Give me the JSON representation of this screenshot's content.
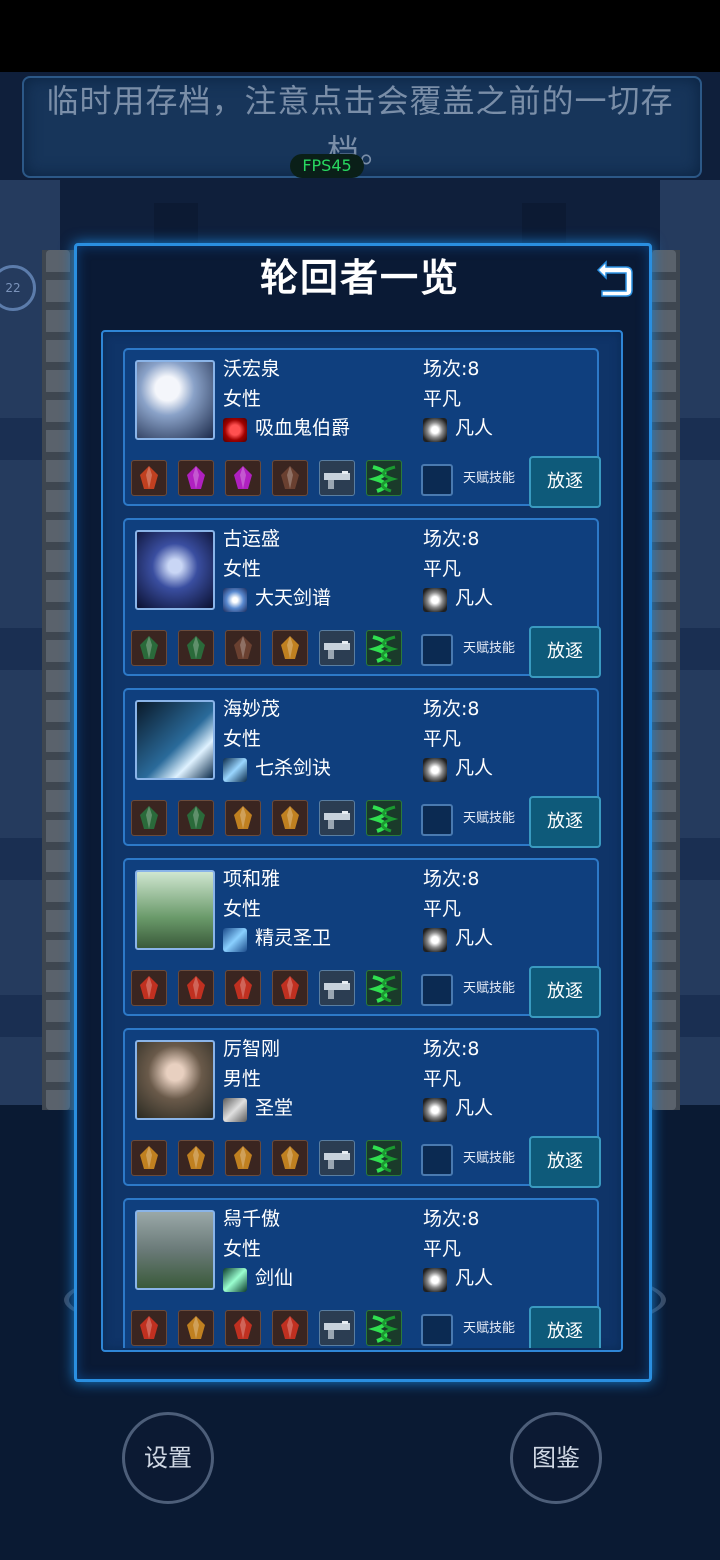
{
  "notice": {
    "line1": "临时用存档，注意点击会覆盖之前的一切存",
    "line2": "档。",
    "fps": "FPS45"
  },
  "side_badge": "22",
  "panel": {
    "title": "轮回者一览",
    "talent_label": "天赋技能",
    "exile_label": "放逐"
  },
  "characters": [
    {
      "name": "沃宏泉",
      "gender": "女性",
      "skill": "吸血鬼伯爵",
      "round": "场次:8",
      "rank": "平凡",
      "grade": "凡人",
      "skill_icon": "red-eye-icon"
    },
    {
      "name": "古运盛",
      "gender": "女性",
      "skill": "大天剑谱",
      "round": "场次:8",
      "rank": "平凡",
      "grade": "凡人",
      "skill_icon": "swirl-blade-icon"
    },
    {
      "name": "海妙茂",
      "gender": "女性",
      "skill": "七杀剑诀",
      "round": "场次:8",
      "rank": "平凡",
      "grade": "凡人",
      "skill_icon": "ice-slash-icon"
    },
    {
      "name": "项和雅",
      "gender": "女性",
      "skill": "精灵圣卫",
      "round": "场次:8",
      "rank": "平凡",
      "grade": "凡人",
      "skill_icon": "arrow-icon"
    },
    {
      "name": "厉智刚",
      "gender": "男性",
      "skill": "圣堂",
      "round": "场次:8",
      "rank": "平凡",
      "grade": "凡人",
      "skill_icon": "crossed-swords-icon"
    },
    {
      "name": "舄千傲",
      "gender": "女性",
      "skill": "剑仙",
      "round": "场次:8",
      "rank": "平凡",
      "grade": "凡人",
      "skill_icon": "sword-x-icon"
    }
  ],
  "bottom": {
    "settings_label": "设置",
    "codex_label": "图鉴"
  },
  "colors": {
    "panel_border": "#2a8fe0",
    "card_bg": "#0f3f7e",
    "exile_bg": "#0e5a7a",
    "fps_text": "#28d860"
  }
}
